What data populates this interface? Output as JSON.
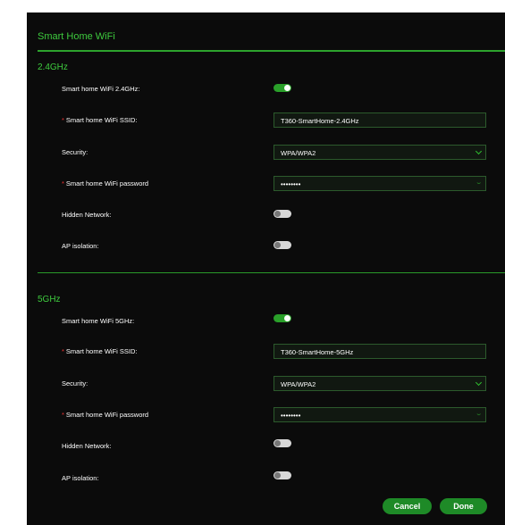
{
  "panel": {
    "title": "Smart Home WiFi"
  },
  "band24": {
    "title": "2.4GHz",
    "toggle_label": "Smart home WiFi 2.4GHz:",
    "toggle_on": true,
    "ssid_label": "Smart home WiFi SSID:",
    "ssid_value": "T360-SmartHome-2.4GHz",
    "security_label": "Security:",
    "security_value": "WPA/WPA2",
    "password_label": "Smart home WiFi password",
    "password_value": "••••••••",
    "hidden_label": "Hidden Network:",
    "hidden_on": false,
    "ap_label": "AP isolation:",
    "ap_on": false
  },
  "band5": {
    "title": "5GHz",
    "toggle_label": "Smart home WiFi 5GHz:",
    "toggle_on": true,
    "ssid_label": "Smart home WiFi SSID:",
    "ssid_value": "T360-SmartHome-5GHz",
    "security_label": "Security:",
    "security_value": "WPA/WPA2",
    "password_label": "Smart home WiFi password",
    "password_value": "••••••••",
    "hidden_label": "Hidden Network:",
    "hidden_on": false,
    "ap_label": "AP isolation:",
    "ap_on": false
  },
  "buttons": {
    "cancel": "Cancel",
    "done": "Done"
  },
  "colors": {
    "accent": "#3ecb3e",
    "button": "#1e8a27",
    "background": "#0b0b0b"
  }
}
